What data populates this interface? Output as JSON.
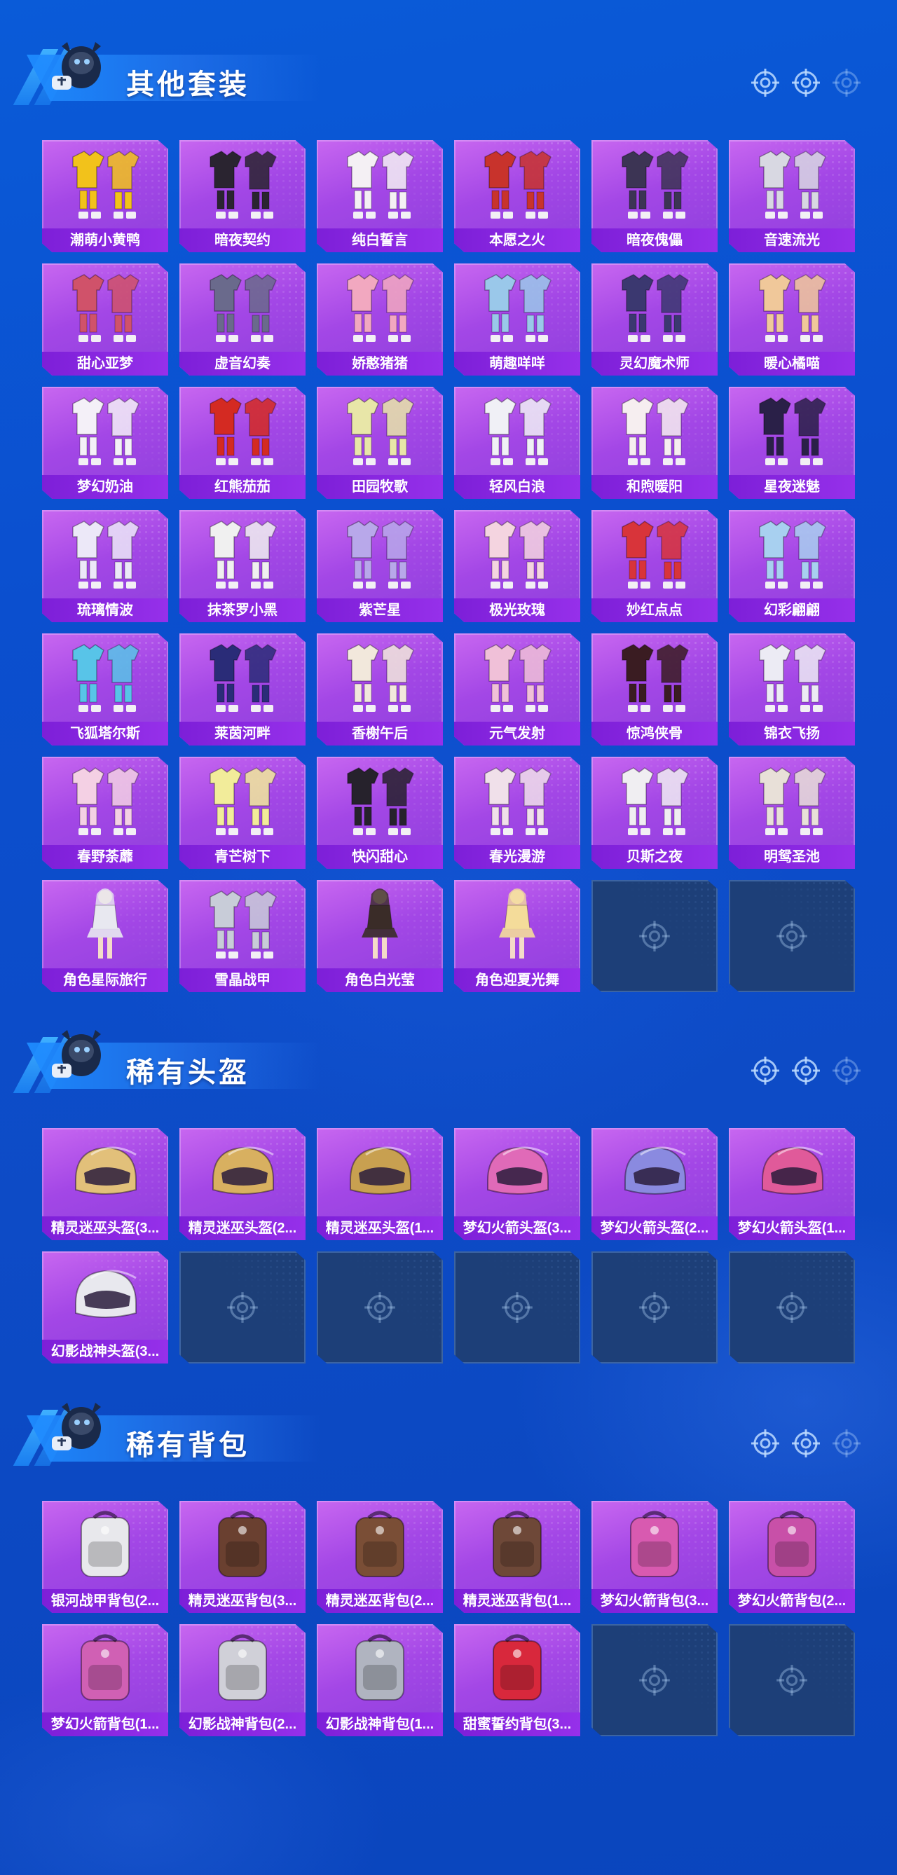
{
  "sections": [
    {
      "title": "其他套装",
      "items": [
        {
          "label": "潮萌小黄鸭",
          "art": "outfit-icon",
          "color": "#f2c21b"
        },
        {
          "label": "暗夜契约",
          "art": "outfit-icon",
          "color": "#2a2430"
        },
        {
          "label": "纯白誓言",
          "art": "outfit-icon",
          "color": "#f4f0f4"
        },
        {
          "label": "本愿之火",
          "art": "outfit-icon",
          "color": "#c8332c"
        },
        {
          "label": "暗夜傀儡",
          "art": "outfit-icon",
          "color": "#3c3454"
        },
        {
          "label": "音速流光",
          "art": "outfit-icon",
          "color": "#d8d8e2"
        },
        {
          "label": "甜心亚梦",
          "art": "outfit-icon",
          "color": "#d0526a"
        },
        {
          "label": "虚音幻奏",
          "art": "outfit-icon",
          "color": "#6a6a8c"
        },
        {
          "label": "娇憨猪猪",
          "art": "outfit-icon",
          "color": "#f2a8c0"
        },
        {
          "label": "萌趣咩咩",
          "art": "outfit-icon",
          "color": "#9ac8ea"
        },
        {
          "label": "灵幻魔术师",
          "art": "outfit-icon",
          "color": "#3b3870"
        },
        {
          "label": "暖心橘喵",
          "art": "outfit-icon",
          "color": "#f0c89a"
        },
        {
          "label": "梦幻奶油",
          "art": "outfit-icon",
          "color": "#f4f0f8"
        },
        {
          "label": "红熊茄茄",
          "art": "outfit-icon",
          "color": "#d42a22"
        },
        {
          "label": "田园牧歌",
          "art": "outfit-icon",
          "color": "#e8e6a8"
        },
        {
          "label": "轻风白浪",
          "art": "outfit-icon",
          "color": "#f0f0f6"
        },
        {
          "label": "和煦暖阳",
          "art": "outfit-icon",
          "color": "#f6eef0"
        },
        {
          "label": "星夜迷魅",
          "art": "outfit-icon",
          "color": "#2a2048"
        },
        {
          "label": "琉璃情波",
          "art": "outfit-icon",
          "color": "#ece8f8"
        },
        {
          "label": "抹茶罗小黑",
          "art": "outfit-icon",
          "color": "#f0f0f0"
        },
        {
          "label": "紫芒星",
          "art": "outfit-icon",
          "color": "#b8a8ea"
        },
        {
          "label": "极光玫瑰",
          "art": "outfit-icon",
          "color": "#f4d4e0"
        },
        {
          "label": "妙红点点",
          "art": "outfit-icon",
          "color": "#d8343a"
        },
        {
          "label": "幻彩翩翩",
          "art": "outfit-icon",
          "color": "#a8d0f0"
        },
        {
          "label": "飞狐塔尔斯",
          "art": "outfit-icon",
          "color": "#58c4e8"
        },
        {
          "label": "莱茵河畔",
          "art": "outfit-icon",
          "color": "#2a2c78"
        },
        {
          "label": "香榭午后",
          "art": "outfit-icon",
          "color": "#f2e8dc"
        },
        {
          "label": "元气发射",
          "art": "outfit-icon",
          "color": "#f0c0d8"
        },
        {
          "label": "惊鸿侠骨",
          "art": "outfit-icon",
          "color": "#3a1c22"
        },
        {
          "label": "锦衣飞扬",
          "art": "outfit-icon",
          "color": "#ecebf4"
        },
        {
          "label": "春野荼蘼",
          "art": "outfit-icon",
          "color": "#f4d0e4"
        },
        {
          "label": "青芒树下",
          "art": "outfit-icon",
          "color": "#f2ec9a"
        },
        {
          "label": "快闪甜心",
          "art": "outfit-icon",
          "color": "#26222c"
        },
        {
          "label": "春光漫游",
          "art": "outfit-icon",
          "color": "#f0e0ea"
        },
        {
          "label": "贝斯之夜",
          "art": "outfit-icon",
          "color": "#f0eef2"
        },
        {
          "label": "明鸳圣池",
          "art": "outfit-icon",
          "color": "#e8e0d8"
        },
        {
          "label": "角色星际旅行",
          "art": "character-icon",
          "color": "#e8e8f0"
        },
        {
          "label": "雪晶战甲",
          "art": "outfit-icon",
          "color": "#c8ccd8"
        },
        {
          "label": "角色白光莹",
          "art": "character-icon",
          "color": "#3a2c28"
        },
        {
          "label": "角色迎夏光舞",
          "art": "character-icon",
          "color": "#f4dc9a"
        },
        {
          "label": "",
          "art": "empty-slot-icon"
        },
        {
          "label": "",
          "art": "empty-slot-icon"
        }
      ]
    },
    {
      "title": "稀有头盔",
      "items": [
        {
          "label": "精灵迷巫头盔(3...",
          "art": "helmet-icon",
          "color": "#e2c07a"
        },
        {
          "label": "精灵迷巫头盔(2...",
          "art": "helmet-icon",
          "color": "#d8b060"
        },
        {
          "label": "精灵迷巫头盔(1...",
          "art": "helmet-icon",
          "color": "#c8a050"
        },
        {
          "label": "梦幻火箭头盔(3...",
          "art": "helmet-icon",
          "color": "#e06ab8"
        },
        {
          "label": "梦幻火箭头盔(2...",
          "art": "helmet-icon",
          "color": "#8a8ae0"
        },
        {
          "label": "梦幻火箭头盔(1...",
          "art": "helmet-icon",
          "color": "#e05a9a"
        },
        {
          "label": "幻影战神头盔(3...",
          "art": "helmet-icon",
          "color": "#e8e8ee"
        },
        {
          "label": "",
          "art": "empty-slot-icon"
        },
        {
          "label": "",
          "art": "empty-slot-icon"
        },
        {
          "label": "",
          "art": "empty-slot-icon"
        },
        {
          "label": "",
          "art": "empty-slot-icon"
        },
        {
          "label": "",
          "art": "empty-slot-icon"
        }
      ]
    },
    {
      "title": "稀有背包",
      "items": [
        {
          "label": "银河战甲背包(2...",
          "art": "backpack-icon",
          "color": "#e8e8ec"
        },
        {
          "label": "精灵迷巫背包(3...",
          "art": "backpack-icon",
          "color": "#6a4030"
        },
        {
          "label": "精灵迷巫背包(2...",
          "art": "backpack-icon",
          "color": "#7a4e36"
        },
        {
          "label": "精灵迷巫背包(1...",
          "art": "backpack-icon",
          "color": "#6e4838"
        },
        {
          "label": "梦幻火箭背包(3...",
          "art": "backpack-icon",
          "color": "#d85ab0"
        },
        {
          "label": "梦幻火箭背包(2...",
          "art": "backpack-icon",
          "color": "#c850a8"
        },
        {
          "label": "梦幻火箭背包(1...",
          "art": "backpack-icon",
          "color": "#d060b4"
        },
        {
          "label": "幻影战神背包(2...",
          "art": "backpack-icon",
          "color": "#d0d0d8"
        },
        {
          "label": "幻影战神背包(1...",
          "art": "backpack-icon",
          "color": "#b0b4c0"
        },
        {
          "label": "甜蜜誓约背包(3...",
          "art": "backpack-icon",
          "color": "#d8283c"
        },
        {
          "label": "",
          "art": "empty-slot-icon"
        },
        {
          "label": "",
          "art": "empty-slot-icon"
        }
      ]
    }
  ],
  "colors": {
    "card_accent": "#a347e6",
    "label_bar": "#7d1fd8",
    "empty_slot": "#1d3f78",
    "background": "#0b4fcf"
  }
}
